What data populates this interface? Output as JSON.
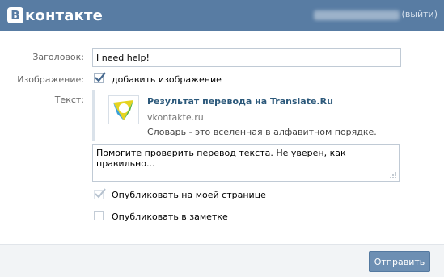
{
  "header": {
    "logo_mark": "В",
    "logo_text": "контакте",
    "logout": "(выйти)"
  },
  "form": {
    "title_label": "Заголовок:",
    "title_value": "I need help!",
    "image_label": "Изображение:",
    "image_checkbox_label": "добавить изображение",
    "image_checked": true,
    "text_label": "Текст:",
    "attachment": {
      "title": "Результат перевода на Translate.Ru",
      "domain": "vkontakte.ru",
      "description": "Словарь - это вселенная в алфавитном порядке."
    },
    "text_value": "Помогите проверить перевод текста. Не уверен, как правильно...",
    "publish_page_label": "Опубликовать на моей странице",
    "publish_page_checked": true,
    "publish_note_label": "Опубликовать в заметке",
    "publish_note_checked": false
  },
  "footer": {
    "send_label": "Отправить"
  },
  "colors": {
    "header_bg": "#587ca3",
    "link": "#2b587a",
    "button": "#6d8fb3"
  }
}
